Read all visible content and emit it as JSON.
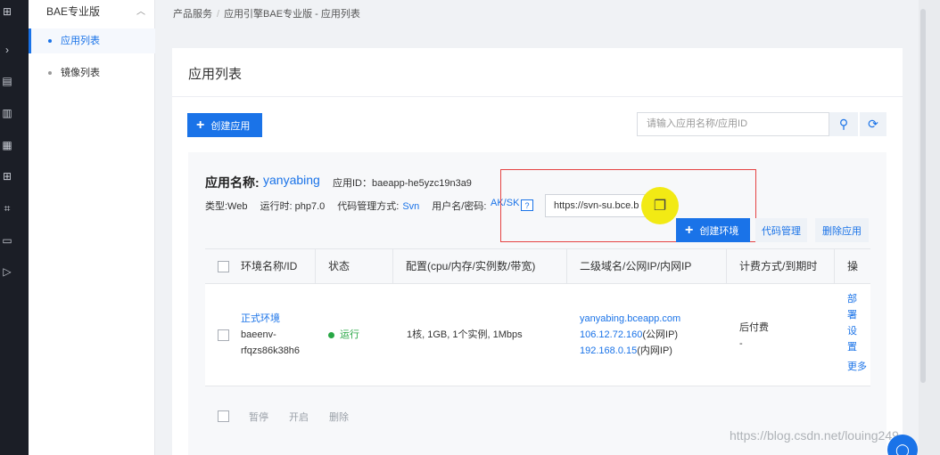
{
  "sidebar": {
    "group_label": "BAE专业版",
    "items": [
      {
        "label": "应用列表",
        "active": true
      },
      {
        "label": "镜像列表",
        "active": false
      }
    ]
  },
  "breadcrumb": {
    "level1": "产品服务",
    "separator": "/",
    "level2": "应用引擎BAE专业版 - 应用列表"
  },
  "page": {
    "title": "应用列表",
    "create_app_label": "创建应用",
    "search_placeholder": "请输入应用名称/应用ID"
  },
  "app": {
    "name_label": "应用名称:",
    "name": "yanyabing",
    "id_text": "应用ID：baeapp-he5yzc19n3a9",
    "type_text": "类型:Web",
    "runtime_text": "运行时: php7.0",
    "code_mgmt_label": "代码管理方式:",
    "code_mgmt_value": "Svn",
    "credentials_label": "用户名/密码:",
    "aksk_label": "AK/SK",
    "help_mark": "?",
    "svn_url": "https://svn-su.bce.b",
    "create_env_label": "创建环境",
    "code_manage_label": "代码管理",
    "delete_app_label": "删除应用"
  },
  "table": {
    "headers": [
      "环境名称/ID",
      "状态",
      "配置(cpu/内存/实例数/带宽)",
      "二级域名/公网IP/内网IP",
      "计费方式/到期时",
      "操"
    ],
    "rows": [
      {
        "env_name": "正式环境",
        "env_id_line1": "baeenv-",
        "env_id_line2": "rfqzs86k38h6",
        "status": "运行",
        "config": "1核, 1GB, 1个实例, 1Mbps",
        "domain": "yanyabing.bceapp.com",
        "public_ip": "106.12.72.160",
        "public_ip_suffix": "(公网IP)",
        "private_ip": "192.168.0.15",
        "private_ip_suffix": "(内网IP)",
        "billing": "后付费",
        "expiry": "-",
        "ops": [
          "部",
          "署",
          "设",
          "置",
          "更多"
        ]
      }
    ]
  },
  "batch": {
    "pause_label": "暂停",
    "start_label": "开启",
    "delete_label": "删除"
  },
  "watermark": "https://blog.csdn.net/louing249",
  "colors": {
    "accent": "#1a73e8",
    "running": "#28a745",
    "highlight_box": "#e54343",
    "cursor_highlight": "#f2ea14"
  },
  "icons": [
    "grid-icon",
    "chevron-right-icon",
    "document-icon",
    "building-icon",
    "server-icon",
    "apps-icon",
    "network-icon",
    "video-icon",
    "play-icon",
    "search-icon",
    "refresh-icon",
    "copy-icon",
    "pointer-cursor-icon",
    "support-icon"
  ]
}
